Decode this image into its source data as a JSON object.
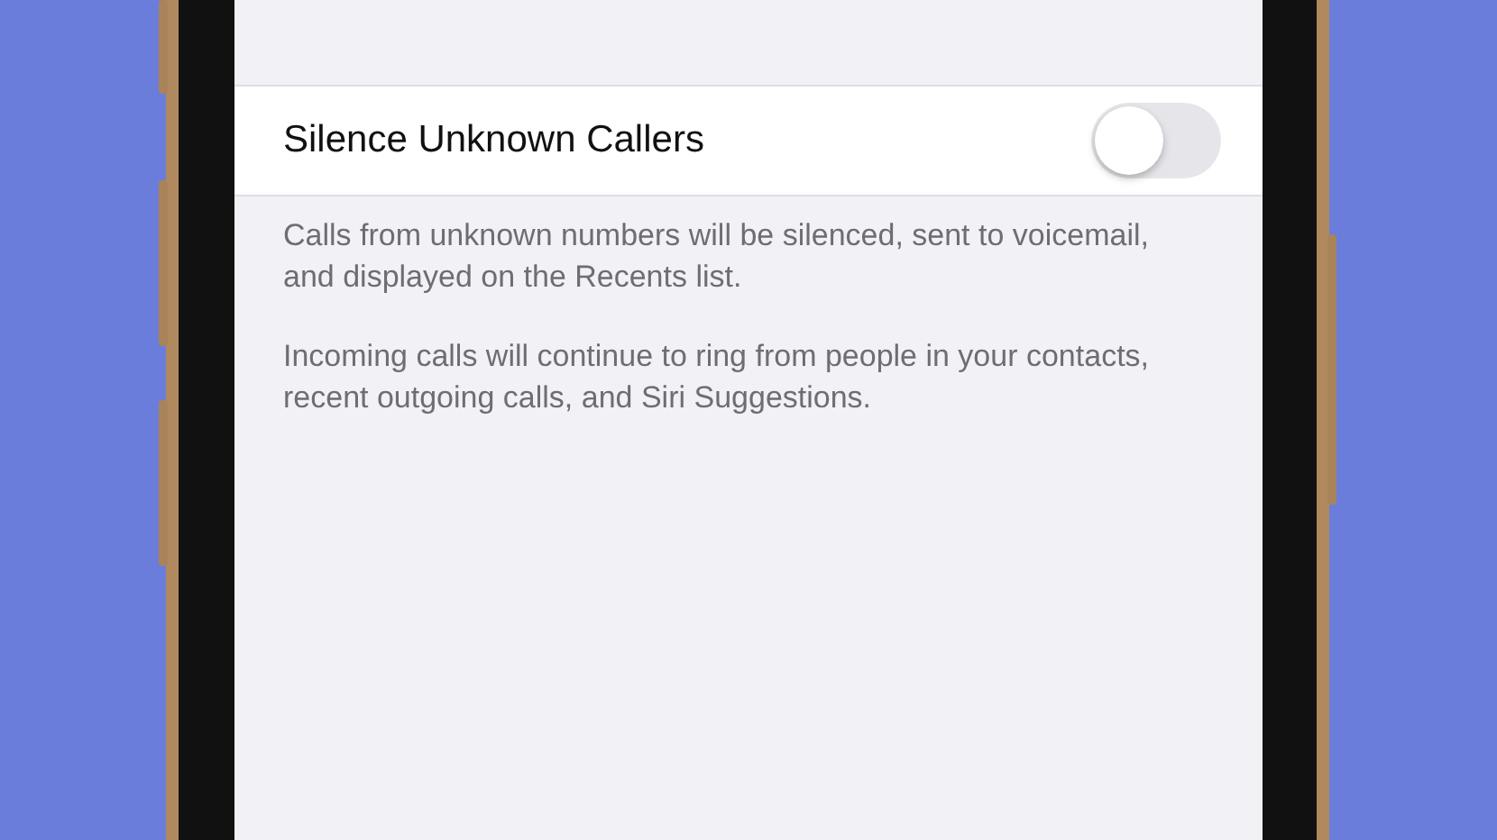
{
  "setting": {
    "label": "Silence Unknown Callers",
    "on": false
  },
  "footer": [
    "Calls from unknown numbers will be silenced, sent to voicemail, and displayed on the Recents list.",
    "Incoming calls will continue to ring from people in your contacts, recent outgoing calls, and Siri Suggestions."
  ]
}
